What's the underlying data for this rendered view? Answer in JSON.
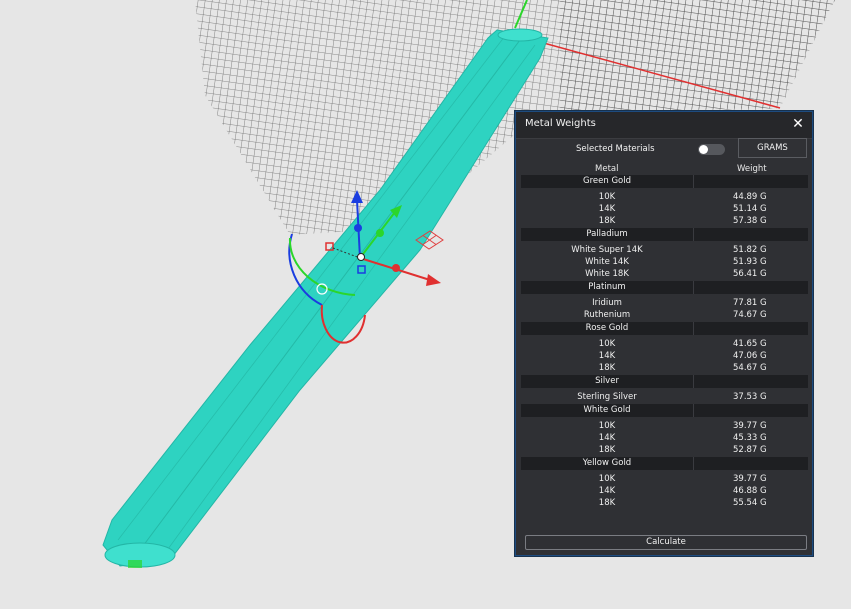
{
  "panel": {
    "title": "Metal Weights",
    "selected_materials_label": "Selected Materials",
    "unit_label": "GRAMS",
    "columns": {
      "metal": "Metal",
      "weight": "Weight"
    },
    "calculate_label": "Calculate",
    "toggle_on": false,
    "groups": [
      {
        "name": "Green Gold",
        "rows": [
          {
            "name": "10K",
            "weight": "44.89 G"
          },
          {
            "name": "14K",
            "weight": "51.14 G"
          },
          {
            "name": "18K",
            "weight": "57.38 G"
          }
        ]
      },
      {
        "name": "Palladium",
        "rows": [
          {
            "name": "White Super 14K",
            "weight": "51.82 G"
          },
          {
            "name": "White 14K",
            "weight": "51.93 G"
          },
          {
            "name": "White 18K",
            "weight": "56.41 G"
          }
        ]
      },
      {
        "name": "Platinum",
        "rows": [
          {
            "name": "Iridium",
            "weight": "77.81 G"
          },
          {
            "name": "Ruthenium",
            "weight": "74.67 G"
          }
        ]
      },
      {
        "name": "Rose Gold",
        "rows": [
          {
            "name": "10K",
            "weight": "41.65 G"
          },
          {
            "name": "14K",
            "weight": "47.06 G"
          },
          {
            "name": "18K",
            "weight": "54.67 G"
          }
        ]
      },
      {
        "name": "Silver",
        "rows": [
          {
            "name": "Sterling Silver",
            "weight": "37.53 G"
          }
        ]
      },
      {
        "name": "White Gold",
        "rows": [
          {
            "name": "10K",
            "weight": "39.77 G"
          },
          {
            "name": "14K",
            "weight": "45.33 G"
          },
          {
            "name": "18K",
            "weight": "52.87 G"
          }
        ]
      },
      {
        "name": "Yellow Gold",
        "rows": [
          {
            "name": "10K",
            "weight": "39.77 G"
          },
          {
            "name": "14K",
            "weight": "46.88 G"
          },
          {
            "name": "18K",
            "weight": "55.54 G"
          }
        ]
      }
    ]
  },
  "colors": {
    "model": "#2ed3c1",
    "axis_x": "#e03030",
    "axis_y": "#2bd62b",
    "axis_z": "#1a3de0",
    "panel_bg": "#2f3034"
  }
}
